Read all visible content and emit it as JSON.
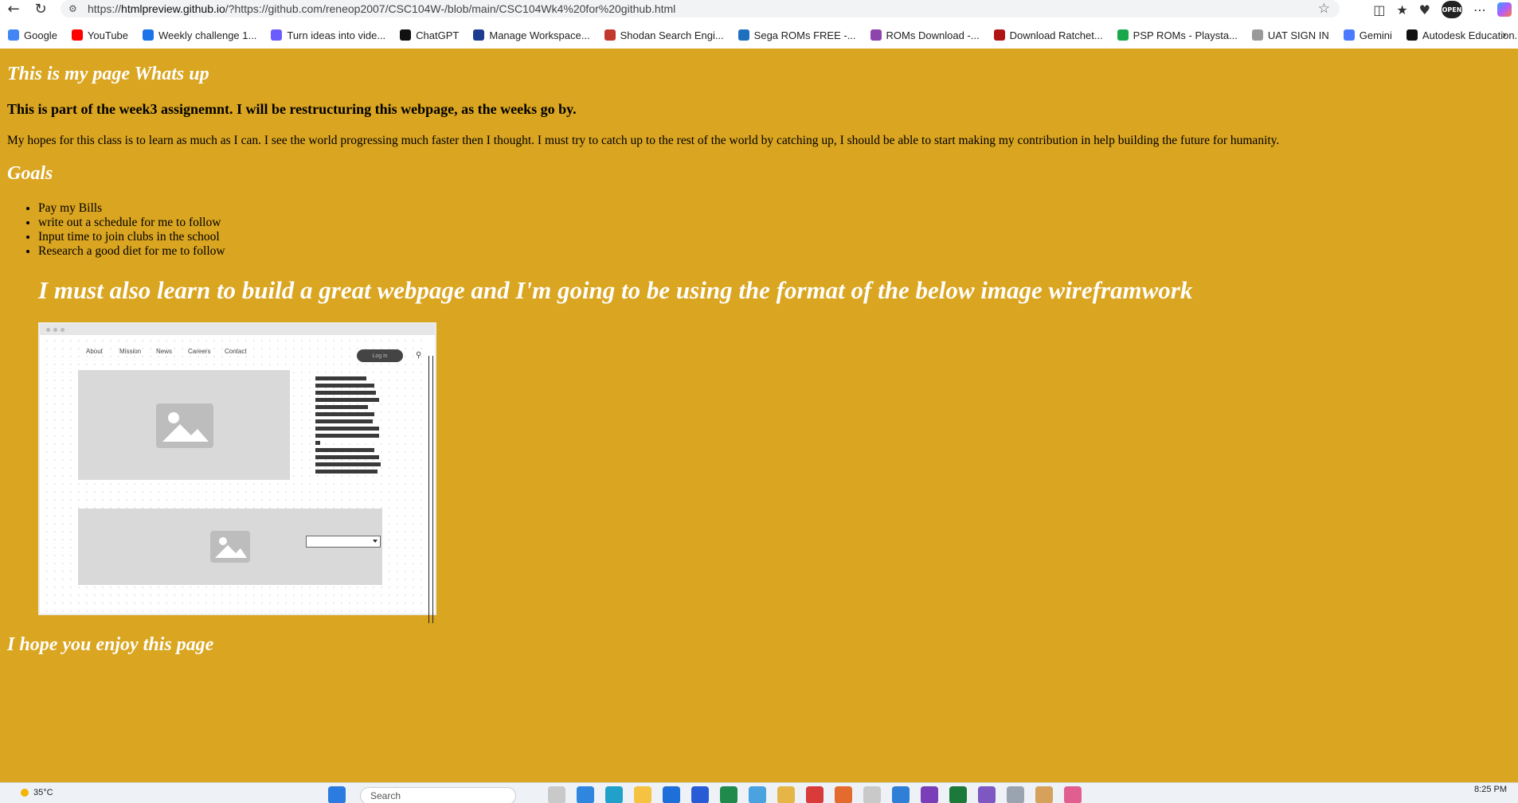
{
  "browser": {
    "url_prefix": "https://",
    "url_host": "htmlpreview.github.io",
    "url_path": "/?https://github.com/reneop2007/CSC104W-/blob/main/CSC104Wk4%20for%20github.html",
    "profile_badge": "OPEN"
  },
  "bookmarks": [
    {
      "label": "Google",
      "color": "#4285F4"
    },
    {
      "label": "YouTube",
      "color": "#FF0000"
    },
    {
      "label": "Weekly challenge 1...",
      "color": "#1a73e8"
    },
    {
      "label": "Turn ideas into vide...",
      "color": "#6a5cff"
    },
    {
      "label": "ChatGPT",
      "color": "#111111"
    },
    {
      "label": "Manage Workspace...",
      "color": "#1d3c8f"
    },
    {
      "label": "Shodan Search Engi...",
      "color": "#c0392b"
    },
    {
      "label": "Sega ROMs FREE -...",
      "color": "#1f6fbf"
    },
    {
      "label": "ROMs Download -...",
      "color": "#8e44ad"
    },
    {
      "label": "Download Ratchet...",
      "color": "#b01515"
    },
    {
      "label": "PSP ROMs - Playsta...",
      "color": "#18a84a"
    },
    {
      "label": "UAT SIGN IN",
      "color": "#999999"
    },
    {
      "label": "Gemini",
      "color": "#4a7bff"
    },
    {
      "label": "Autodesk Education...",
      "color": "#111111"
    }
  ],
  "page": {
    "background": "#DAA520",
    "title": "This is my page Whats up",
    "subtitle": "This is part of the week3 assignemnt. I will be restructuring this webpage, as the weeks go by.",
    "paragraph": "My hopes for this class is to learn as much as I can. I see the world progressing much faster then I thought. I must try to catch up to the rest of the world by catching up, I should be able to start making my contribution in help building the future for humanity.",
    "goals_heading": "Goals",
    "goals": [
      "Pay my Bills",
      "write out a schedule for me to follow",
      "Input time to join clubs in the school",
      "Research a good diet for me to follow"
    ],
    "big_heading": "I must also learn to build a great webpage and I'm going to be using the format of the below image wireframwork",
    "closing": "I hope you enjoy this page"
  },
  "wireframe": {
    "nav": [
      "About",
      "Mission",
      "News",
      "Careers",
      "Contact"
    ],
    "login_label": "Log in"
  },
  "taskbar": {
    "temperature": "35°C",
    "search_placeholder": "Search",
    "time": "8:25 PM"
  }
}
